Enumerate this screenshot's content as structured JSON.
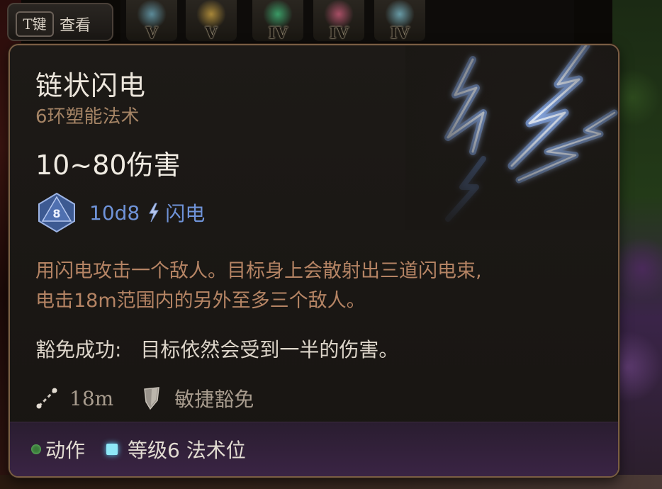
{
  "hotbar": {
    "view_key": "T键",
    "view_label": "查看",
    "slots": [
      {
        "level": "V",
        "color": "#6aa5b8"
      },
      {
        "level": "V",
        "color": "#c8a040"
      },
      {
        "level": "IV",
        "color": "#3fb878"
      },
      {
        "level": "IV",
        "color": "#c85a78"
      },
      {
        "level": "IV",
        "color": "#78b8c8"
      }
    ]
  },
  "tooltip": {
    "title": "链状闪电",
    "subtitle": "6环塑能法术",
    "damage": "10~80伤害",
    "dice_number": "8",
    "damage_dice": "10d8",
    "damage_type": "闪电",
    "description_line1": "用闪电攻击一个敌人。目标身上会散射出三道闪电束,",
    "description_line2": "电击18m范围内的另外至多三个敌人。",
    "save_label": "豁免成功:",
    "save_text": "目标依然会受到一半的伤害。",
    "range": "18m",
    "save_type": "敏捷豁免",
    "footer_action": "动作",
    "footer_slot": "等级6 法术位"
  },
  "colors": {
    "accent_lightning": "#6f93d8",
    "description": "#b58464",
    "subtitle": "#a58465",
    "action_dot": "#3a7a3a",
    "spell_slot": "#8ee8f8"
  }
}
